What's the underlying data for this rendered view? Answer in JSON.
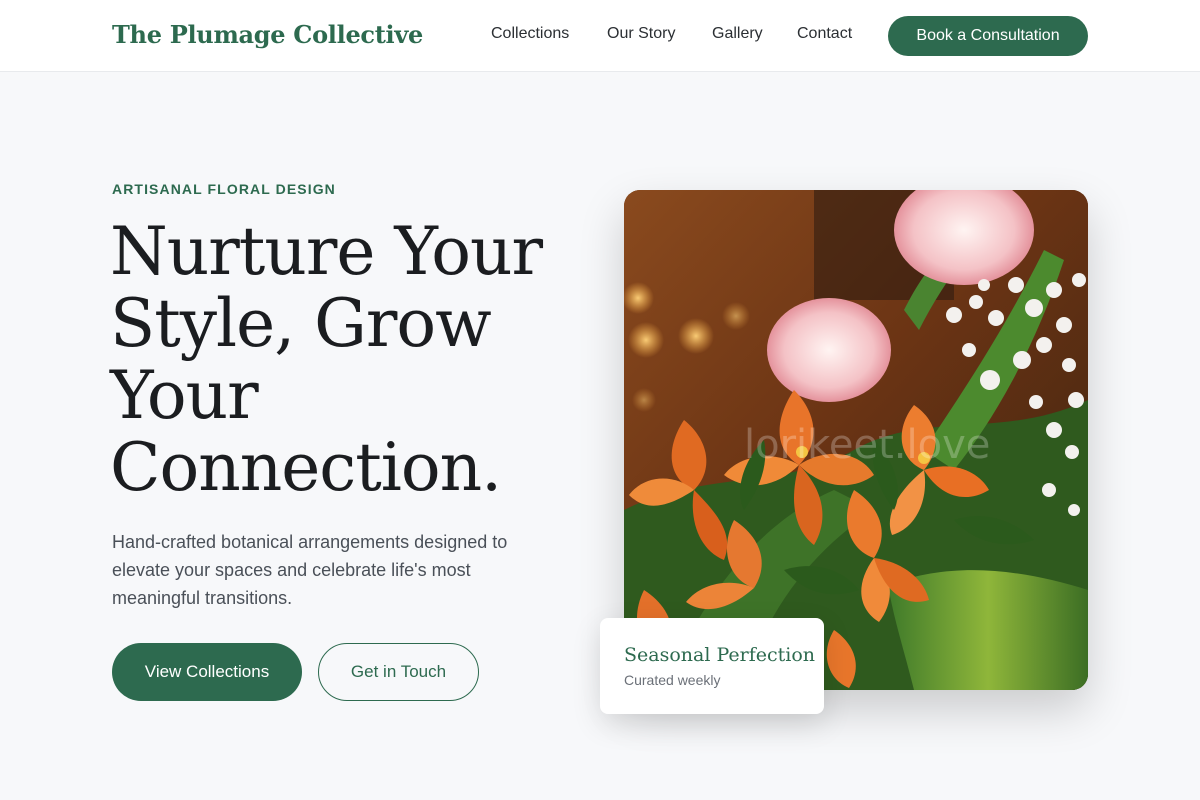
{
  "header": {
    "brand": "The Plumage Collective",
    "nav": [
      "Collections",
      "Our Story",
      "Gallery",
      "Contact"
    ],
    "cta": "Book a Consultation"
  },
  "hero": {
    "eyebrow": "ARTISANAL FLORAL DESIGN",
    "headline": "Nurture Your Style, Grow Your Connection.",
    "lede": "Hand-crafted botanical arrangements designed to elevate your spaces and celebrate life's most meaningful transitions.",
    "primary_button": "View Collections",
    "secondary_button": "Get in Touch",
    "image_watermark": "lorikeet.love"
  },
  "card": {
    "title": "Seasonal Perfection",
    "subtitle": "Curated weekly"
  },
  "colors": {
    "accent": "#2d6a4f",
    "background": "#f7f8fa",
    "text": "#1b1d20"
  },
  "icons": {
    "hero_image": "flower-bouquet-photo"
  }
}
